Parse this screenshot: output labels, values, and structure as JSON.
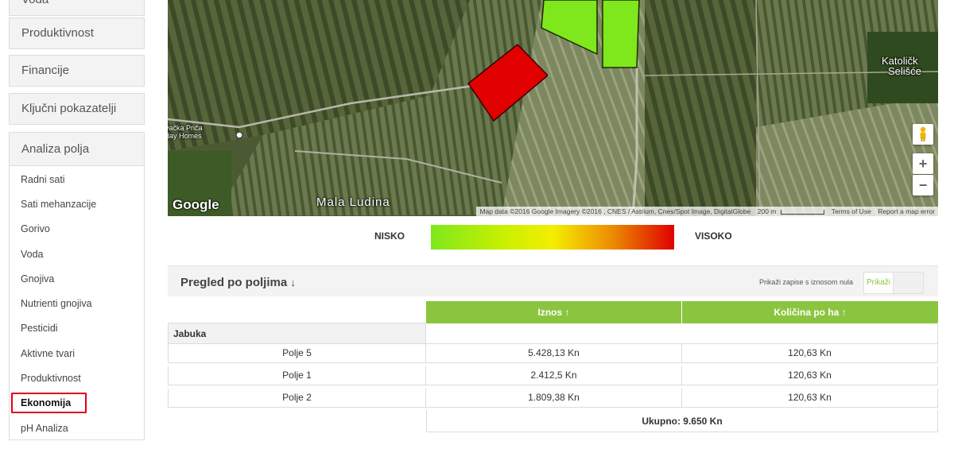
{
  "sidebar": {
    "top_buttons": [
      {
        "label": "Voda"
      },
      {
        "label": "Produktivnost"
      },
      {
        "label": "Financije"
      },
      {
        "label": "Ključni pokazatelji"
      },
      {
        "label": "Analiza polja"
      }
    ],
    "sub_items": [
      {
        "label": "Radni sati"
      },
      {
        "label": "Sati mehanzacije"
      },
      {
        "label": "Gorivo"
      },
      {
        "label": "Voda"
      },
      {
        "label": "Gnojiva"
      },
      {
        "label": "Nutrienti gnojiva"
      },
      {
        "label": "Pesticidi"
      },
      {
        "label": "Aktivne tvari"
      },
      {
        "label": "Produktivnost"
      },
      {
        "label": "Ekonomija"
      },
      {
        "label": "pH Analiza"
      }
    ],
    "active_item": "Ekonomija",
    "active_color": "#e0001a"
  },
  "map": {
    "logo": "Google",
    "labels": {
      "place_left": "vačka Priča",
      "place_left_2": "day Homes",
      "village": "Mala Ludina",
      "top_right": "Katoličk",
      "top_right_2": "Selišće"
    },
    "attribution": "Map data ©2016 Google Imagery ©2016 , CNES / Astrium, Cnes/Spot Image, DigitalGlobe",
    "scale": "200 m",
    "terms": "Terms of Use",
    "report": "Report a map error",
    "zoom_in": "+",
    "zoom_out": "−",
    "field_colors": {
      "low": "#7fe81c",
      "high": "#e00000"
    }
  },
  "legend": {
    "low": "NISKO",
    "high": "VISOKO"
  },
  "panel": {
    "title": "Pregled po poljima",
    "title_icon": "arrow-down-icon",
    "show_zero_note": "Prikaži zapise s iznosom nula",
    "show_button": "Prikaži",
    "accent": "#8bc53f"
  },
  "table": {
    "headers": {
      "amount": "Iznos ↑",
      "per_ha": "Količina po ha ↑"
    },
    "group": "Jabuka",
    "rows": [
      {
        "field": "Polje 5",
        "amount": "5.428,13 Kn",
        "per_ha": "120,63 Kn"
      },
      {
        "field": "Polje 1",
        "amount": "2.412,5 Kn",
        "per_ha": "120,63 Kn"
      },
      {
        "field": "Polje 2",
        "amount": "1.809,38 Kn",
        "per_ha": "120,63 Kn"
      }
    ],
    "total": "Ukupno: 9.650 Kn"
  }
}
